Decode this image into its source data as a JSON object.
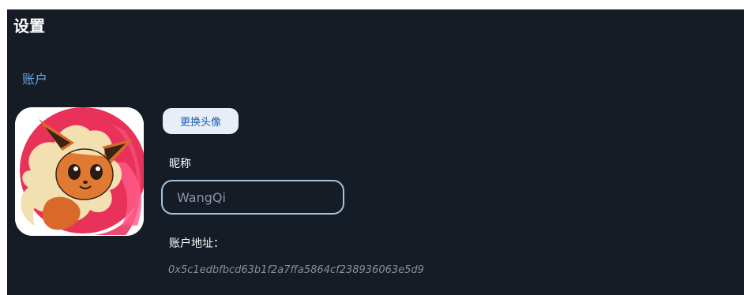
{
  "page": {
    "title": "设置"
  },
  "account": {
    "section_title": "账户",
    "change_avatar_label": "更换头像",
    "nickname_label": "昵称",
    "nickname_value": "WangQi",
    "address_label": "账户地址：",
    "address_value": "0x5c1edbfbcd63b1f2a7ffa5864cf238936063e5d9"
  },
  "avatar": {
    "icon": "flareon-character-avatar"
  },
  "colors": {
    "background": "#151c25",
    "accent": "#6aa0e6",
    "button_bg": "#e8eef7",
    "button_text": "#1e5fae",
    "input_border": "#a7c2de"
  }
}
